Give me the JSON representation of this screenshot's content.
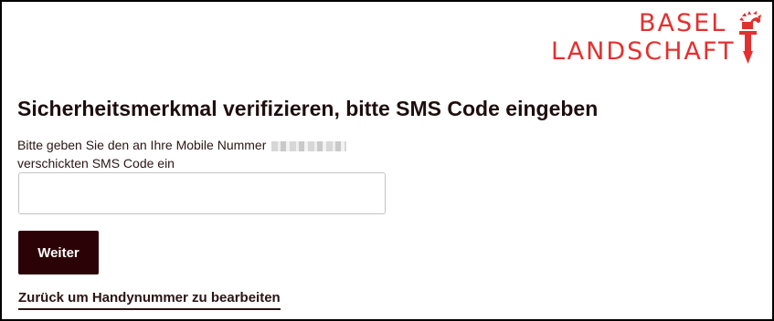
{
  "header": {
    "logo": {
      "line1": "BASEL",
      "line2": "LANDSCHAFT",
      "mark_icon": "baselstab-crozier-icon",
      "brand_color": "#e3302f"
    }
  },
  "main": {
    "title": "Sicherheitsmerkmal verifizieren, bitte SMS Code eingeben",
    "description_line1": "Bitte geben Sie den an Ihre Mobile Nummer",
    "description_line2": "verschickten SMS Code ein",
    "sms_input": {
      "value": "",
      "placeholder": ""
    },
    "next_button_label": "Weiter",
    "back_link_label": "Zurück um Handynummer zu bearbeiten"
  },
  "colors": {
    "button_bg": "#2b0306",
    "text": "#1f0e0e",
    "input_border": "#c4c4c4"
  }
}
